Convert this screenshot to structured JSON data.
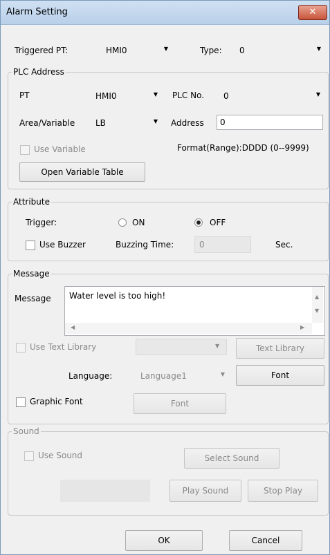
{
  "title": "Alarm Setting",
  "close_glyph": "✕",
  "top": {
    "triggered_pt_label": "Triggered PT:",
    "triggered_pt_value": "HMI0",
    "type_label": "Type:",
    "type_value": "0"
  },
  "plc": {
    "legend": "PLC Address",
    "pt_label": "PT",
    "pt_value": "HMI0",
    "plc_no_label": "PLC No.",
    "plc_no_value": "0",
    "area_label": "Area/Variable",
    "area_value": "LB",
    "address_label": "Address",
    "address_value": "0",
    "use_variable": "Use Variable",
    "format": "Format(Range):DDDD (0--9999)",
    "open_table": "Open Variable Table"
  },
  "attribute": {
    "legend": "Attribute",
    "trigger_label": "Trigger:",
    "on_label": "ON",
    "off_label": "OFF",
    "trigger_selected": "OFF",
    "use_buzzer": "Use Buzzer",
    "buzzing_time_label": "Buzzing Time:",
    "buzzing_time_value": "0",
    "sec_label": "Sec."
  },
  "message": {
    "legend": "Message",
    "label": "Message",
    "text": "Water level is too high!",
    "use_text_library": "Use Text Library",
    "text_library_button": "Text Library",
    "language_label": "Language:",
    "language_value": "Language1",
    "font_button": "Font",
    "graphic_font": "Graphic Font",
    "graphic_font_button": "Font"
  },
  "sound": {
    "legend": "Sound",
    "use_sound": "Use Sound",
    "select_sound": "Select Sound",
    "play_sound": "Play Sound",
    "stop_play": "Stop Play"
  },
  "footer": {
    "ok": "OK",
    "cancel": "Cancel"
  },
  "colors": {
    "title_bg": "#c4d8ee",
    "close_bg": "#c8543a",
    "dialog_bg": "#f0f0f0"
  }
}
